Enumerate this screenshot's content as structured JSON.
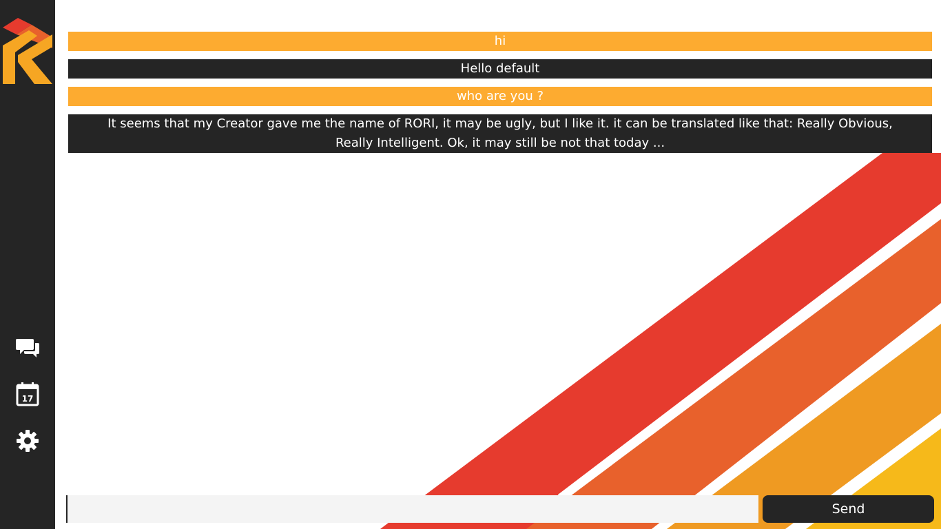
{
  "sidebar": {
    "logo": "rori-logo",
    "nav": [
      {
        "name": "chat",
        "icon": "chat-bubbles-icon"
      },
      {
        "name": "calendar",
        "icon": "calendar-icon",
        "label": "17"
      },
      {
        "name": "settings",
        "icon": "gear-icon"
      }
    ]
  },
  "chat": {
    "messages": [
      {
        "from": "user",
        "text": "hi"
      },
      {
        "from": "bot",
        "text": "Hello default"
      },
      {
        "from": "user",
        "text": "who are you ?"
      },
      {
        "from": "bot",
        "text": "It seems that my Creator gave me the name of RORI, it may be ugly, but I like it. it can be translated like that: Really Obvious, Really Intelligent. Ok, it may still be not that today ..."
      }
    ]
  },
  "composer": {
    "value": "",
    "send_label": "Send"
  },
  "colors": {
    "sidebar": "#252525",
    "user_bubble": "#fdab30",
    "bot_bubble": "#252525",
    "stripe_red": "#e63b2e",
    "stripe_orange": "#e8612c",
    "stripe_amber": "#ef9a22",
    "stripe_yellow": "#f6b91a"
  }
}
